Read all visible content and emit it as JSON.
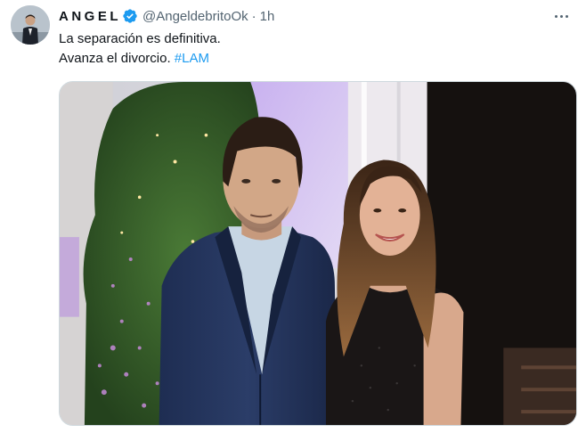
{
  "tweet": {
    "display_name": "ANGEL",
    "handle": "@AngeldebritoOk",
    "separator": "·",
    "time": "1h",
    "text_line1": "La separación es definitiva.",
    "text_line2": "Avanza el divorcio. ",
    "hashtag": "#LAM"
  },
  "colors": {
    "link": "#1d9bf0",
    "verified": "#1d9bf0",
    "secondary_text": "#536471"
  },
  "icons": {
    "verified": "verified-badge-icon",
    "more": "more-options-icon"
  }
}
